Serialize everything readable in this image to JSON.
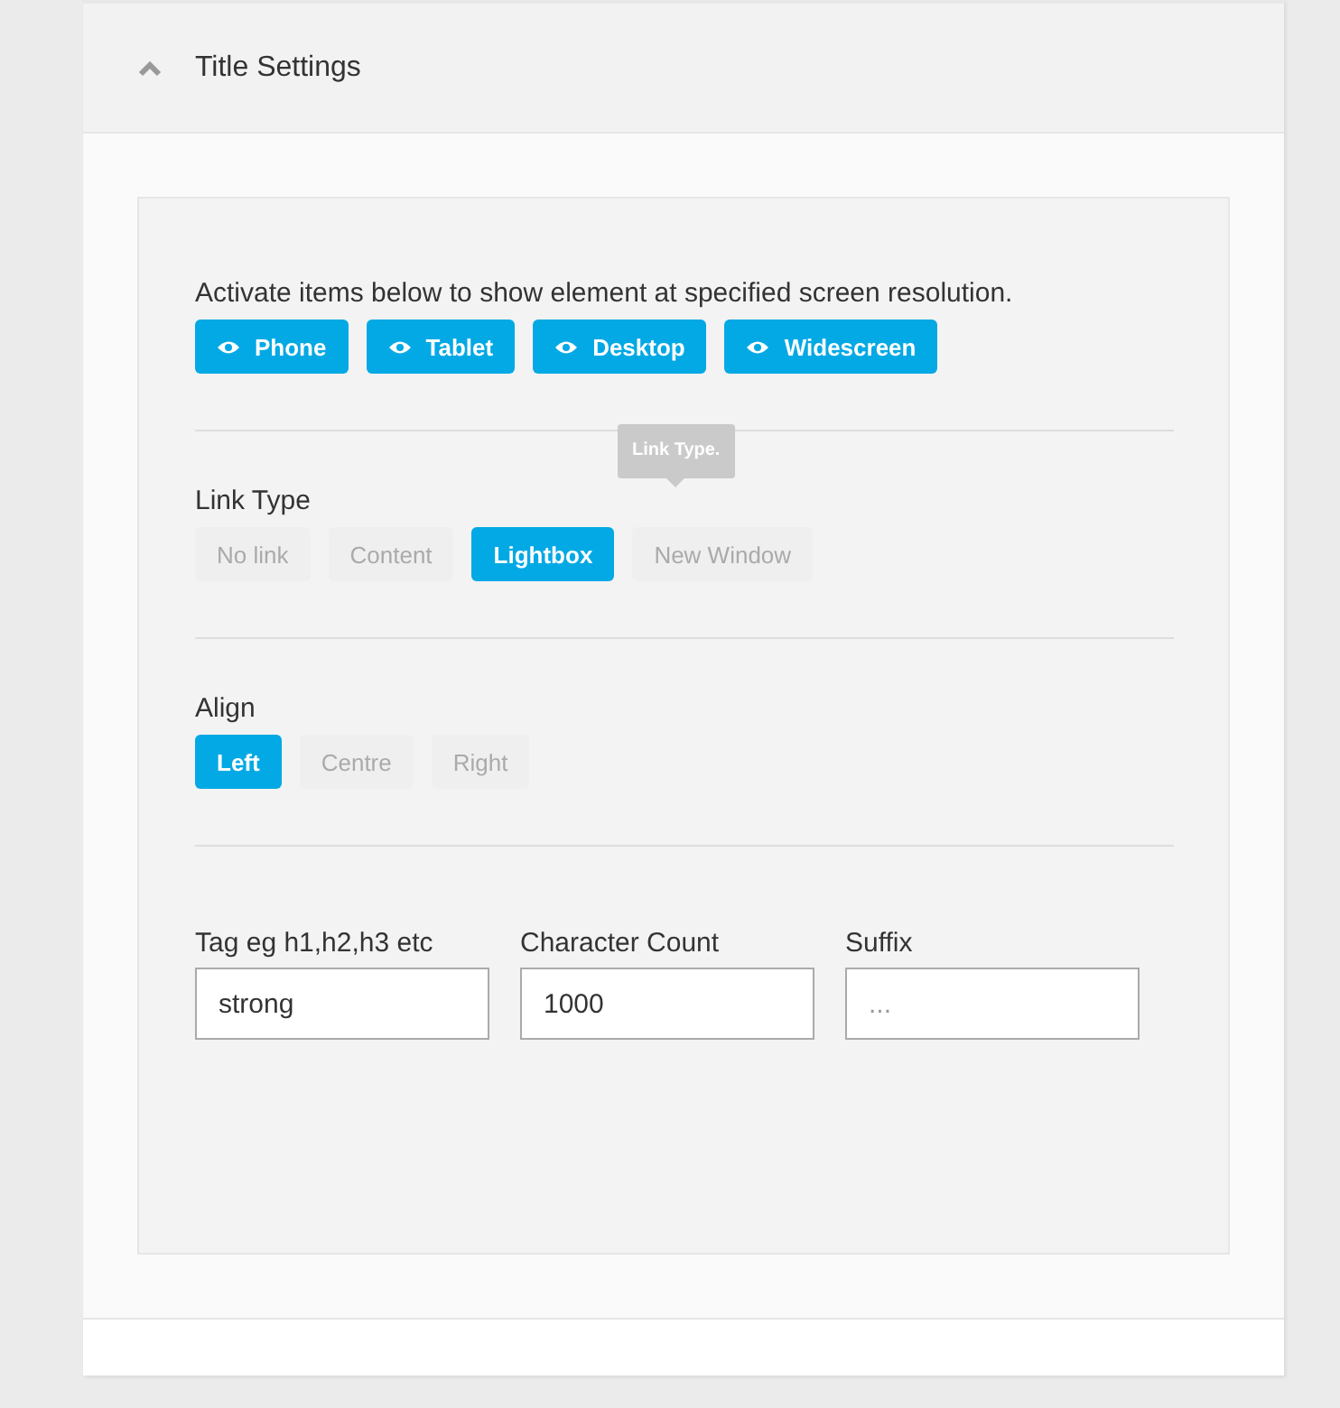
{
  "section": {
    "title": "Title Settings",
    "expanded": true
  },
  "visibility": {
    "description": "Activate items below to show element at specified screen resolution.",
    "devices": [
      {
        "label": "Phone",
        "on": true
      },
      {
        "label": "Tablet",
        "on": true
      },
      {
        "label": "Desktop",
        "on": true
      },
      {
        "label": "Widescreen",
        "on": true
      }
    ]
  },
  "link_type": {
    "label": "Link Type",
    "tooltip": "Link Type.",
    "options": [
      {
        "label": "No link",
        "selected": false
      },
      {
        "label": "Content",
        "selected": false
      },
      {
        "label": "Lightbox",
        "selected": true
      },
      {
        "label": "New Window",
        "selected": false
      }
    ]
  },
  "align": {
    "label": "Align",
    "options": [
      {
        "label": "Left",
        "selected": true
      },
      {
        "label": "Centre",
        "selected": false
      },
      {
        "label": "Right",
        "selected": false
      }
    ]
  },
  "fields": [
    {
      "label": "Tag eg h1,h2,h3 etc",
      "value": "strong"
    },
    {
      "label": "Character Count",
      "value": "1000"
    },
    {
      "label": "Suffix",
      "placeholder": "..."
    }
  ]
}
